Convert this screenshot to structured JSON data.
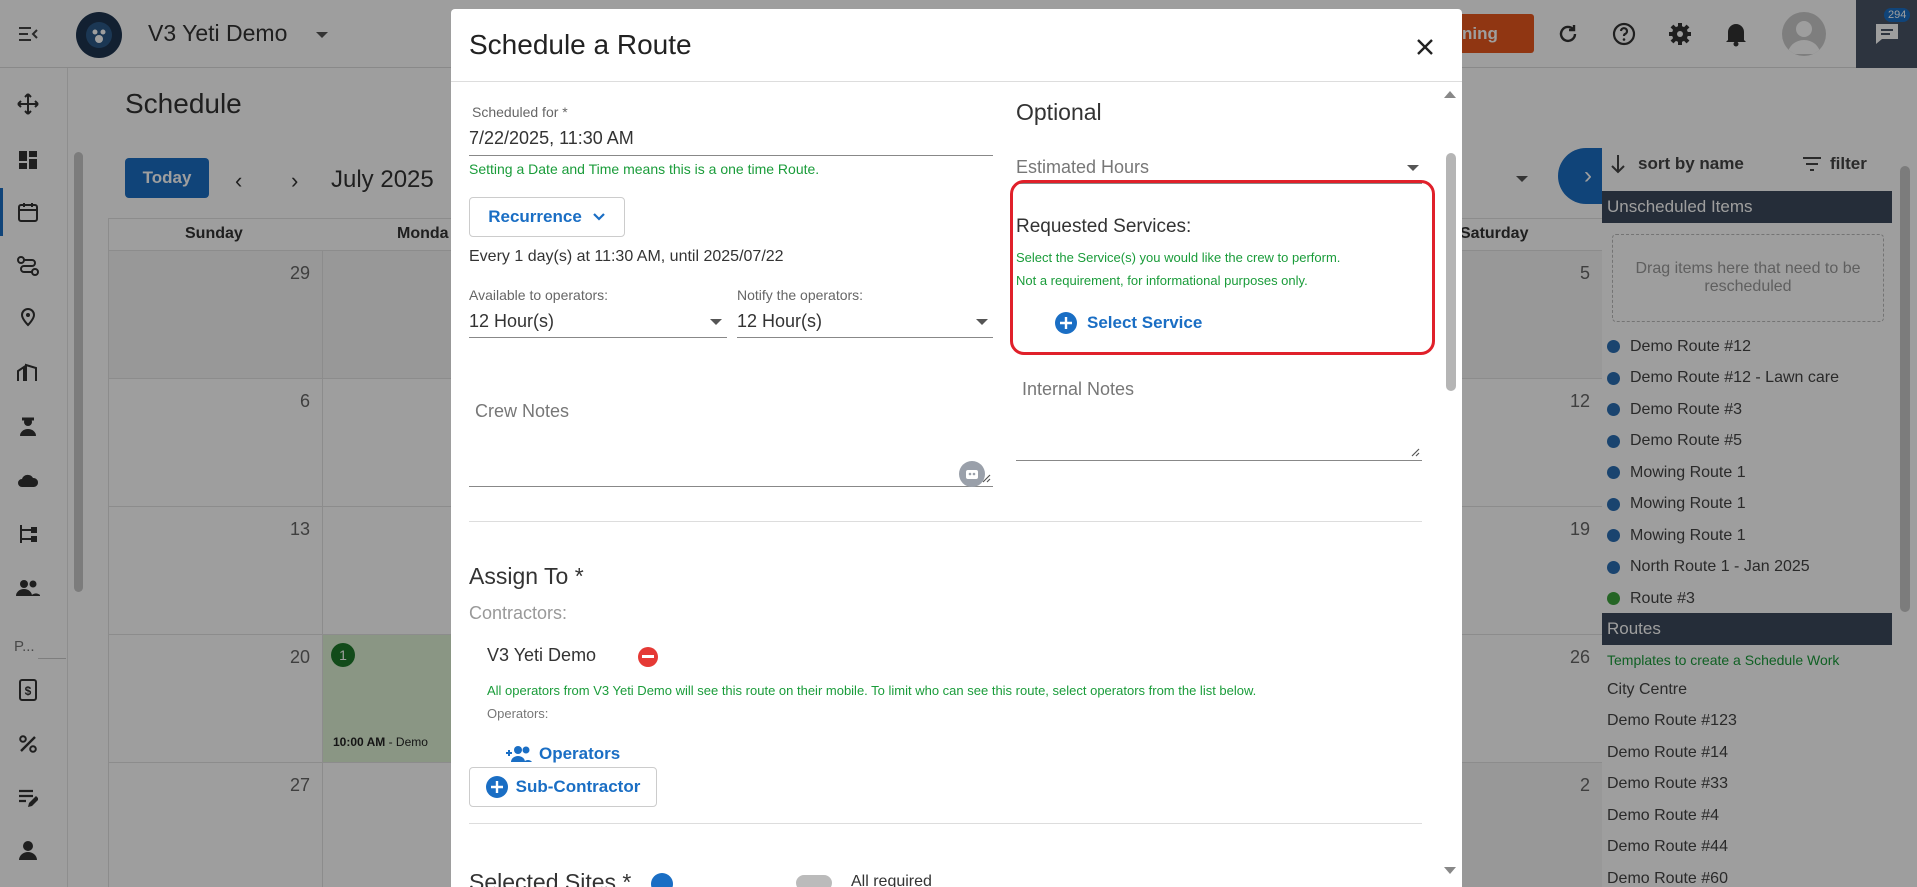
{
  "app": {
    "title": "V3 Yeti Demo",
    "warning_btn_label": "ning",
    "chat_badge": "294"
  },
  "page": {
    "title": "Schedule",
    "today_label": "Today",
    "month_label": "July 2025",
    "weekdays": [
      "Sunday",
      "Monda",
      "Saturday"
    ],
    "left_nav_short": "P..."
  },
  "calendar": {
    "sunday_dates": [
      "29",
      "6",
      "13",
      "20",
      "27"
    ],
    "saturday_dates": [
      "5",
      "12",
      "19",
      "26",
      "2"
    ],
    "event_badge": "1",
    "event_time": "10:00 AM",
    "event_text": "- Demo"
  },
  "right_panel": {
    "sort_label": "sort by name",
    "filter_label": "filter",
    "unscheduled_header": "Unscheduled Items",
    "drop_text": "Drag items here that need to be rescheduled",
    "unscheduled_items": [
      {
        "label": "Demo Route #12",
        "color": "#2a6fb3"
      },
      {
        "label": "Demo Route #12 - Lawn care",
        "color": "#2a6fb3"
      },
      {
        "label": "Demo Route #3",
        "color": "#2a6fb3"
      },
      {
        "label": "Demo Route #5",
        "color": "#2a6fb3"
      },
      {
        "label": "Mowing Route 1",
        "color": "#2a6fb3"
      },
      {
        "label": "Mowing Route 1",
        "color": "#2a6fb3"
      },
      {
        "label": "Mowing Route 1",
        "color": "#2a6fb3"
      },
      {
        "label": "North Route 1 - Jan 2025",
        "color": "#2a6fb3"
      },
      {
        "label": "Route #3",
        "color": "#3ca33c"
      }
    ],
    "routes_header": "Routes",
    "routes_subtitle": "Templates to create a Schedule Work",
    "routes": [
      "City Centre",
      "Demo Route #123",
      "Demo Route #14",
      "Demo Route #33",
      "Demo Route #4",
      "Demo Route #44",
      "Demo Route #60"
    ]
  },
  "modal": {
    "title": "Schedule a Route",
    "scheduled_for_label": "Scheduled for  *",
    "scheduled_for_value": "7/22/2025, 11:30 AM",
    "one_time_note": "Setting a Date and Time means this is a one time Route.",
    "recurrence_label": "Recurrence",
    "recurrence_summary": "Every 1 day(s) at 11:30 AM, until 2025/07/22",
    "available_label": "Available to operators:",
    "available_value": "12 Hour(s)",
    "notify_label": "Notify the operators:",
    "notify_value": "12 Hour(s)",
    "crew_notes_placeholder": "Crew Notes",
    "optional_title": "Optional",
    "estimated_hours_placeholder": "Estimated Hours",
    "requested_services_title": "Requested Services:",
    "requested_services_note1": "Select the Service(s) you would like the crew to perform.",
    "requested_services_note2": "Not a requirement, for informational purposes only.",
    "select_service_label": "Select Service",
    "internal_notes_placeholder": "Internal Notes",
    "assign_to_title": "Assign To *",
    "contractors_label": "Contractors:",
    "contractor_name": "V3 Yeti Demo",
    "operators_note": "All operators from V3 Yeti Demo will see this route on their mobile. To limit who can see this route, select operators from the list below.",
    "operators_label": "Operators:",
    "operators_btn": "Operators",
    "subcontractor_btn": "Sub-Contractor",
    "selected_sites_label": "Selected Sites *",
    "all_required_label": "All required"
  },
  "colors": {
    "accent": "#1a6ec4",
    "nav_dark": "#3d4a5c",
    "highlight_red": "#e0202a",
    "warning_orange": "#e9571e",
    "success_green": "#1a9c3a"
  }
}
